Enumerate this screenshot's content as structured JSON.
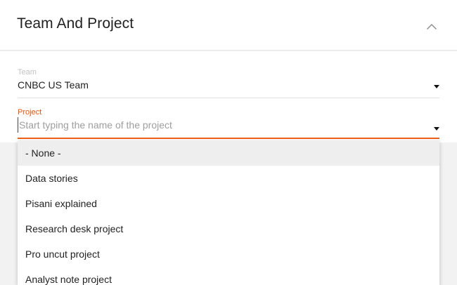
{
  "panel": {
    "title": "Team And Project",
    "collapse_icon": "chevron-up-icon"
  },
  "team_field": {
    "label": "Team",
    "value": "CNBC US Team",
    "dropdown_icon": "caret-down-icon"
  },
  "project_field": {
    "label": "Project",
    "value": "",
    "placeholder": "Start typing the name of the project",
    "dropdown_icon": "caret-down-icon",
    "accent_color": "#f0601a"
  },
  "dropdown": {
    "options": [
      {
        "label": "- None -",
        "highlighted": true
      },
      {
        "label": "Data stories",
        "highlighted": false
      },
      {
        "label": "Pisani explained",
        "highlighted": false
      },
      {
        "label": "Research desk project",
        "highlighted": false
      },
      {
        "label": "Pro uncut project",
        "highlighted": false
      },
      {
        "label": "Analyst note project",
        "highlighted": false
      }
    ]
  }
}
